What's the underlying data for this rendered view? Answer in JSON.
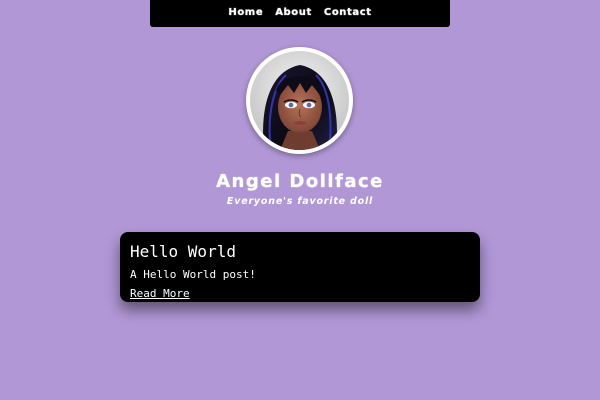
{
  "nav": {
    "items": [
      {
        "label": "Home"
      },
      {
        "label": "About"
      },
      {
        "label": "Contact"
      }
    ]
  },
  "profile": {
    "name": "Angel Dollface",
    "tagline": "Everyone's favorite doll",
    "avatar_icon": "doll-portrait"
  },
  "posts": [
    {
      "title": "Hello World",
      "excerpt": "A Hello World post!",
      "link_label": "Read More"
    }
  ],
  "colors": {
    "background": "#b197d6",
    "nav_bg": "#000000",
    "card_bg": "#000000",
    "text": "#ffffff"
  }
}
